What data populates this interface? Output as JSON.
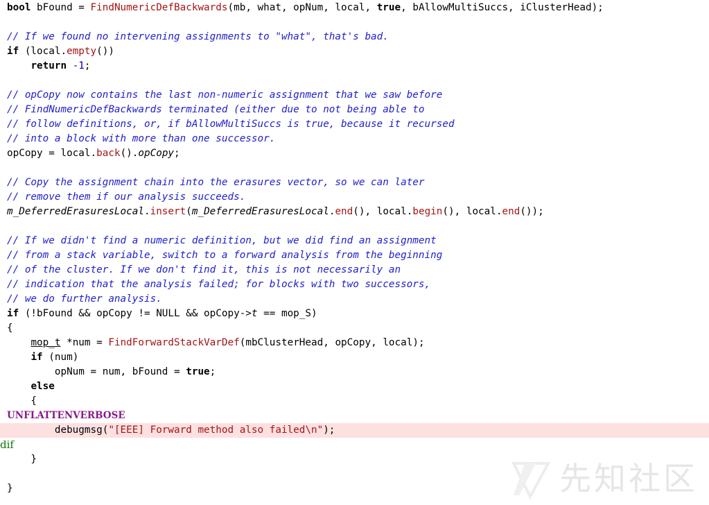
{
  "editor": {
    "lines": [
      {
        "highlight": false,
        "tokens": [
          {
            "t": "bool",
            "c": "kw"
          },
          {
            "t": " bFound = "
          },
          {
            "t": "FindNumericDefBackwards",
            "c": "fn"
          },
          {
            "t": "(mb, what, opNum, local, "
          },
          {
            "t": "true",
            "c": "kw"
          },
          {
            "t": ", bAllowMultiSuccs, iClusterHead);"
          }
        ]
      },
      {
        "highlight": false,
        "tokens": []
      },
      {
        "highlight": false,
        "tokens": [
          {
            "t": "// If we found no intervening assignments to \"what\", that's bad.",
            "c": "cm"
          }
        ]
      },
      {
        "highlight": false,
        "tokens": [
          {
            "t": "if",
            "c": "kw"
          },
          {
            "t": " (local."
          },
          {
            "t": "empty",
            "c": "fn"
          },
          {
            "t": "())"
          }
        ]
      },
      {
        "highlight": false,
        "tokens": [
          {
            "t": "    "
          },
          {
            "t": "return",
            "c": "kw"
          },
          {
            "t": " "
          },
          {
            "t": "-1",
            "c": "num"
          },
          {
            "t": ";"
          }
        ]
      },
      {
        "highlight": false,
        "tokens": []
      },
      {
        "highlight": false,
        "tokens": [
          {
            "t": "// opCopy now contains the last non-numeric assignment that we saw before",
            "c": "cm"
          }
        ]
      },
      {
        "highlight": false,
        "tokens": [
          {
            "t": "// FindNumericDefBackwards terminated (either due to not being able to",
            "c": "cm"
          }
        ]
      },
      {
        "highlight": false,
        "tokens": [
          {
            "t": "// follow definitions, or, if bAllowMultiSuccs is true, because it recursed",
            "c": "cm"
          }
        ]
      },
      {
        "highlight": false,
        "tokens": [
          {
            "t": "// into a block with more than one successor.",
            "c": "cm"
          }
        ]
      },
      {
        "highlight": false,
        "tokens": [
          {
            "t": "opCopy = local."
          },
          {
            "t": "back",
            "c": "fn"
          },
          {
            "t": "()."
          },
          {
            "t": "opCopy",
            "c": "it"
          },
          {
            "t": ";"
          }
        ]
      },
      {
        "highlight": false,
        "tokens": []
      },
      {
        "highlight": false,
        "tokens": [
          {
            "t": "// Copy the assignment chain into the erasures vector, so we can later",
            "c": "cm"
          }
        ]
      },
      {
        "highlight": false,
        "tokens": [
          {
            "t": "// remove them if our analysis succeeds.",
            "c": "cm"
          }
        ]
      },
      {
        "highlight": false,
        "tokens": [
          {
            "t": "m_DeferredErasuresLocal",
            "c": "it"
          },
          {
            "t": "."
          },
          {
            "t": "insert",
            "c": "fn"
          },
          {
            "t": "("
          },
          {
            "t": "m_DeferredErasuresLocal",
            "c": "it"
          },
          {
            "t": "."
          },
          {
            "t": "end",
            "c": "fn"
          },
          {
            "t": "(), local."
          },
          {
            "t": "begin",
            "c": "fn"
          },
          {
            "t": "(), local."
          },
          {
            "t": "end",
            "c": "fn"
          },
          {
            "t": "());"
          }
        ]
      },
      {
        "highlight": false,
        "tokens": []
      },
      {
        "highlight": false,
        "tokens": [
          {
            "t": "// If we didn't find a numeric definition, but we did find an assignment",
            "c": "cm"
          }
        ]
      },
      {
        "highlight": false,
        "tokens": [
          {
            "t": "// from a stack variable, switch to a forward analysis from the beginning",
            "c": "cm"
          }
        ]
      },
      {
        "highlight": false,
        "tokens": [
          {
            "t": "// of the cluster. If we don't find it, this is not necessarily an",
            "c": "cm"
          }
        ]
      },
      {
        "highlight": false,
        "tokens": [
          {
            "t": "// indication that the analysis failed; for blocks with two successors,",
            "c": "cm"
          }
        ]
      },
      {
        "highlight": false,
        "tokens": [
          {
            "t": "// we do further analysis.",
            "c": "cm"
          }
        ]
      },
      {
        "highlight": false,
        "tokens": [
          {
            "t": "if",
            "c": "kw"
          },
          {
            "t": " (!bFound && opCopy != NULL && opCopy->"
          },
          {
            "t": "t",
            "c": "it"
          },
          {
            "t": " == mop_S)"
          }
        ]
      },
      {
        "highlight": false,
        "tokens": [
          {
            "t": "{"
          }
        ]
      },
      {
        "highlight": false,
        "tokens": [
          {
            "t": "    "
          },
          {
            "t": "mop_t",
            "c": "ul"
          },
          {
            "t": " *num = "
          },
          {
            "t": "FindForwardStackVarDef",
            "c": "fn"
          },
          {
            "t": "(mbClusterHead, opCopy, local);"
          }
        ]
      },
      {
        "highlight": false,
        "tokens": [
          {
            "t": "    "
          },
          {
            "t": "if",
            "c": "kw"
          },
          {
            "t": " (num)"
          }
        ]
      },
      {
        "highlight": false,
        "tokens": [
          {
            "t": "        opNum = num, bFound = "
          },
          {
            "t": "true",
            "c": "kw"
          },
          {
            "t": ";"
          }
        ]
      },
      {
        "highlight": false,
        "tokens": [
          {
            "t": "    "
          },
          {
            "t": "else",
            "c": "kw"
          }
        ]
      },
      {
        "highlight": false,
        "tokens": [
          {
            "t": "    {"
          }
        ]
      },
      {
        "highlight": false,
        "tokens": [
          {
            "t": "UNFLATTENVERBOSE",
            "c": "pp-purple"
          }
        ]
      },
      {
        "highlight": true,
        "tokens": [
          {
            "t": "        debugmsg("
          },
          {
            "t": "\"[EEE] Forward method also failed\\n\"",
            "c": "str"
          },
          {
            "t": ");"
          }
        ]
      },
      {
        "highlight": false,
        "tokens": [
          {
            "t": "dif",
            "c": "pp-green"
          }
        ]
      },
      {
        "highlight": false,
        "tokens": [
          {
            "t": "    }"
          }
        ]
      },
      {
        "highlight": false,
        "tokens": []
      },
      {
        "highlight": false,
        "tokens": [
          {
            "t": "}"
          }
        ]
      }
    ]
  },
  "watermark": {
    "text": "先知社区",
    "icon": "xianzhi-logo-icon",
    "color": "#e6e6e6"
  },
  "colors": {
    "keyword": "#000000",
    "function": "#a31515",
    "comment": "#2020cc",
    "string": "#a31515",
    "number": "#0000aa",
    "preprocessor_directive": "#8a1a8a",
    "preprocessor_tail": "#0a7a0a",
    "highlight_line": "#fde0e0"
  }
}
